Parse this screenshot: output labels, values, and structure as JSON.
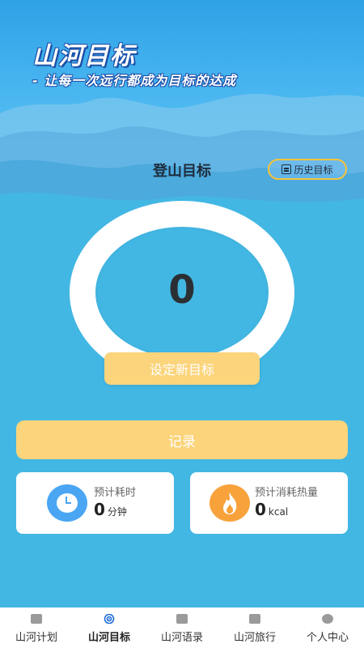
{
  "header": {
    "app_title": "山河目标",
    "slogan": "- 让每一次远行都成为目标的达成"
  },
  "goal_section": {
    "title": "登山目标",
    "history_button": "历史目标",
    "current_value": "0",
    "set_goal_button": "设定新目标"
  },
  "record_button": "记录",
  "stats": {
    "time": {
      "label": "预计耗时",
      "value": "0",
      "unit": "分钟",
      "icon": "clock-icon"
    },
    "calories": {
      "label": "预计消耗热量",
      "value": "0",
      "unit": "kcal",
      "icon": "flame-icon"
    }
  },
  "tabbar": {
    "tabs": [
      {
        "label": "山河计划",
        "icon": "briefcase-icon"
      },
      {
        "label": "山河目标",
        "icon": "target-icon",
        "active": true
      },
      {
        "label": "山河语录",
        "icon": "notebook-icon"
      },
      {
        "label": "山河旅行",
        "icon": "chat-icon"
      },
      {
        "label": "个人中心",
        "icon": "person-icon"
      }
    ]
  },
  "colors": {
    "background": "#43b7e3",
    "button": "#fbd47b",
    "history_border": "#f5c33b",
    "title_outline": "#1b4fa8",
    "active_tab": "#1e6bd9"
  }
}
